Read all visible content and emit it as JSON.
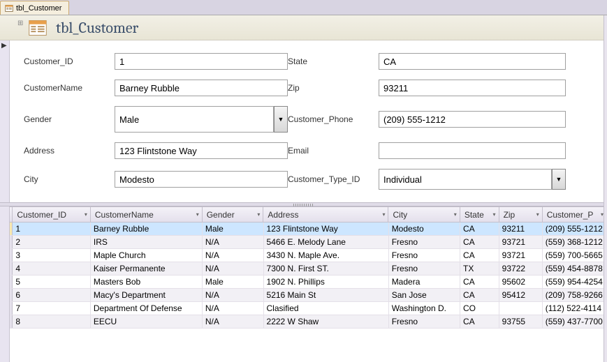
{
  "tab": {
    "label": "tbl_Customer"
  },
  "header": {
    "title": "tbl_Customer"
  },
  "form": {
    "labels": {
      "customer_id": "Customer_ID",
      "customer_name": "CustomerName",
      "gender": "Gender",
      "address": "Address",
      "city": "City",
      "state": "State",
      "zip": "Zip",
      "phone": "Customer_Phone",
      "email": "Email",
      "type": "Customer_Type_ID"
    },
    "values": {
      "customer_id": "1",
      "customer_name": "Barney Rubble",
      "gender": "Male",
      "address": "123 Flintstone Way",
      "city": "Modesto",
      "state": "CA",
      "zip": "93211",
      "phone": "(209) 555-1212",
      "email": "",
      "type": "Individual"
    }
  },
  "grid": {
    "columns": [
      "Customer_ID",
      "CustomerName",
      "Gender",
      "Address",
      "City",
      "State",
      "Zip",
      "Customer_P"
    ],
    "rows": [
      {
        "id": "1",
        "name": "Barney Rubble",
        "gender": "Male",
        "addr": "123 Flintstone Way",
        "city": "Modesto",
        "state": "CA",
        "zip": "93211",
        "phone": "(209) 555-1212"
      },
      {
        "id": "2",
        "name": "IRS",
        "gender": "N/A",
        "addr": "5466 E. Melody Lane",
        "city": "Fresno",
        "state": "CA",
        "zip": "93721",
        "phone": "(559) 368-1212"
      },
      {
        "id": "3",
        "name": "Maple Church",
        "gender": "N/A",
        "addr": "3430 N. Maple Ave.",
        "city": "Fresno",
        "state": "CA",
        "zip": "93721",
        "phone": "(559) 700-5665"
      },
      {
        "id": "4",
        "name": "Kaiser Permanente",
        "gender": "N/A",
        "addr": "7300 N. First ST.",
        "city": "Fresno",
        "state": "TX",
        "zip": "93722",
        "phone": "(559) 454-8878"
      },
      {
        "id": "5",
        "name": "Masters Bob",
        "gender": "Male",
        "addr": "1902 N. Phillips",
        "city": "Madera",
        "state": "CA",
        "zip": "95602",
        "phone": "(559) 954-4254"
      },
      {
        "id": "6",
        "name": "Macy's Department",
        "gender": "N/A",
        "addr": "5216 Main St",
        "city": "San Jose",
        "state": "CA",
        "zip": "95412",
        "phone": "(209) 758-9266"
      },
      {
        "id": "7",
        "name": "Department Of Defense",
        "gender": "N/A",
        "addr": "Clasified",
        "city": "Washington D.",
        "state": "CO",
        "zip": "",
        "phone": "(112) 522-4114"
      },
      {
        "id": "8",
        "name": "EECU",
        "gender": "N/A",
        "addr": "2222 W Shaw",
        "city": "Fresno",
        "state": "CA",
        "zip": "93755",
        "phone": "(559) 437-7700"
      }
    ]
  }
}
